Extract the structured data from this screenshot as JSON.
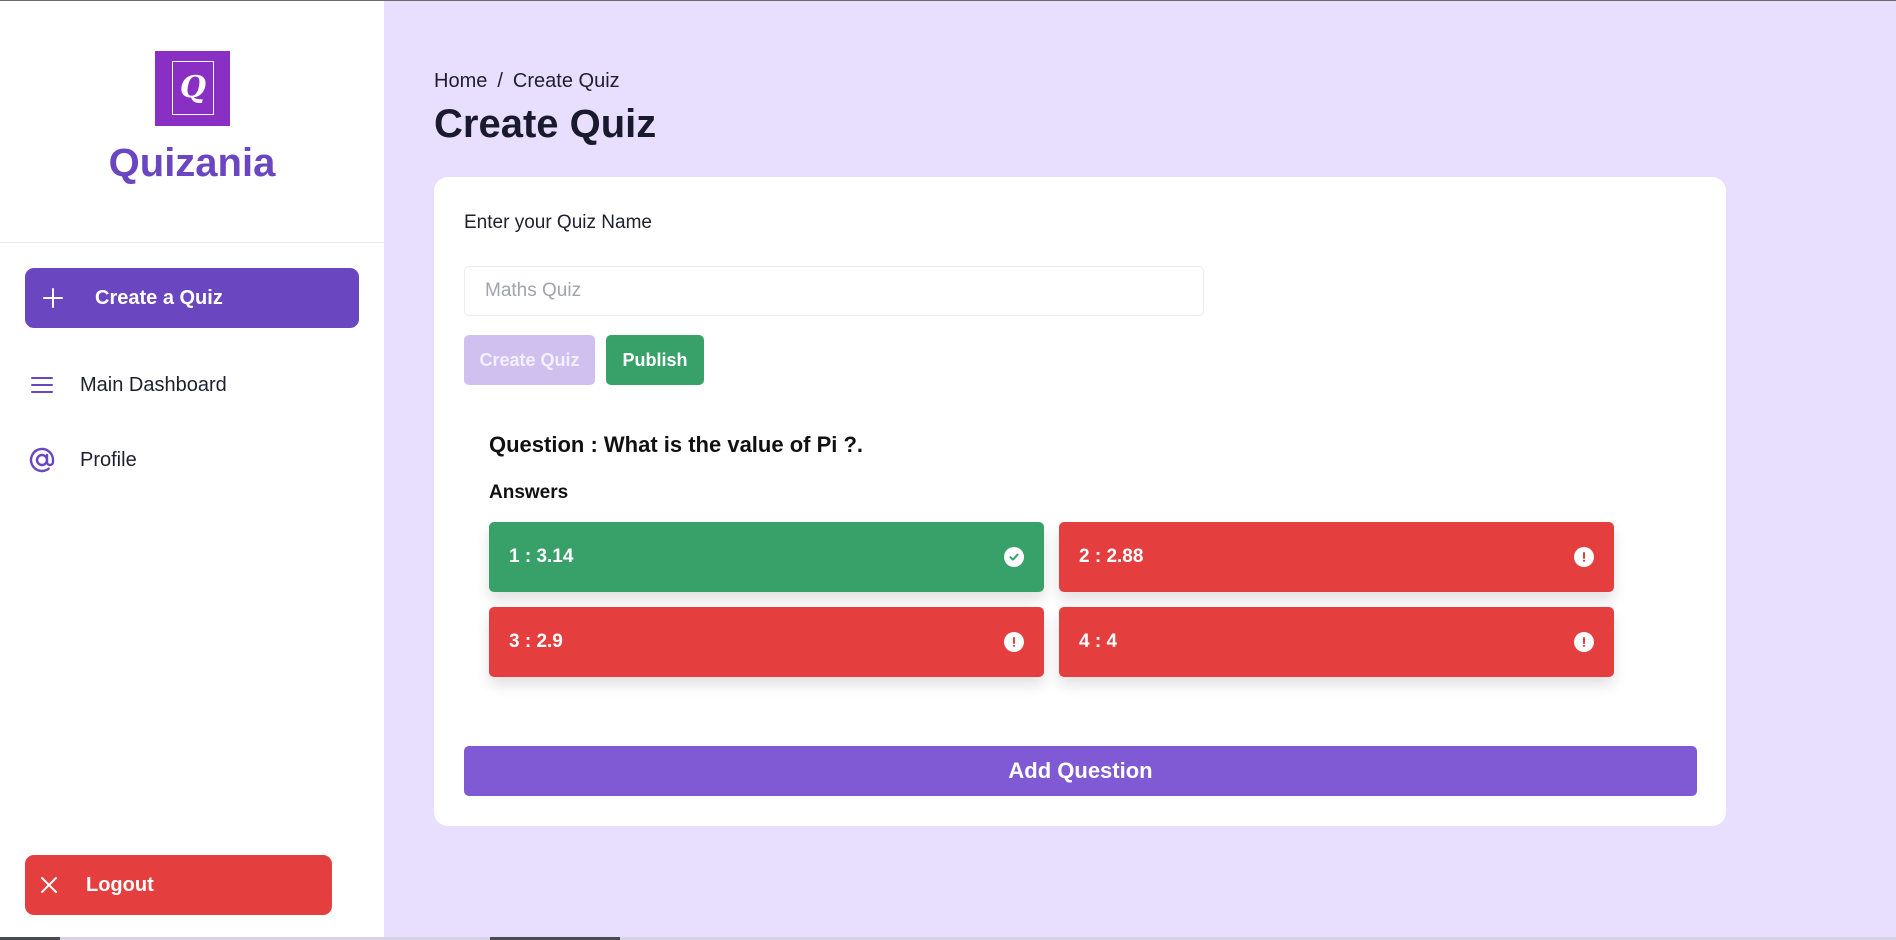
{
  "brand": {
    "name": "Quizania",
    "logo_letter": "Q",
    "logo_color": "#8a2fc4",
    "accent": "#6b46c1"
  },
  "sidebar": {
    "create_button": {
      "label": "Create a Quiz",
      "icon": "plus-icon"
    },
    "items": [
      {
        "label": "Main Dashboard",
        "icon": "menu-icon"
      },
      {
        "label": "Profile",
        "icon": "at-sign-icon"
      }
    ],
    "logout_button": {
      "label": "Logout",
      "icon": "close-icon",
      "color": "#e53e3e"
    }
  },
  "breadcrumb": {
    "home": "Home",
    "separator": "/",
    "current": "Create Quiz"
  },
  "page": {
    "title": "Create Quiz"
  },
  "form": {
    "quiz_name_label": "Enter your Quiz Name",
    "quiz_name_value": "",
    "quiz_name_placeholder": "Maths Quiz",
    "create_button": "Create Quiz",
    "publish_button": "Publish"
  },
  "question": {
    "text": "Question : What is the value of Pi ?.",
    "answers_label": "Answers",
    "answers": [
      {
        "label": "1 : 3.14",
        "status": "correct",
        "icon": "check-circle-icon"
      },
      {
        "label": "2 : 2.88",
        "status": "wrong",
        "icon": "exclamation-circle-icon"
      },
      {
        "label": "3 : 2.9",
        "status": "wrong",
        "icon": "exclamation-circle-icon"
      },
      {
        "label": "4 : 4",
        "status": "wrong",
        "icon": "exclamation-circle-icon"
      }
    ]
  },
  "add_question_button": "Add Question",
  "colors": {
    "correct": "#38a169",
    "wrong": "#e53e3e",
    "background": "#e8defd",
    "add_button": "#805ad5"
  }
}
